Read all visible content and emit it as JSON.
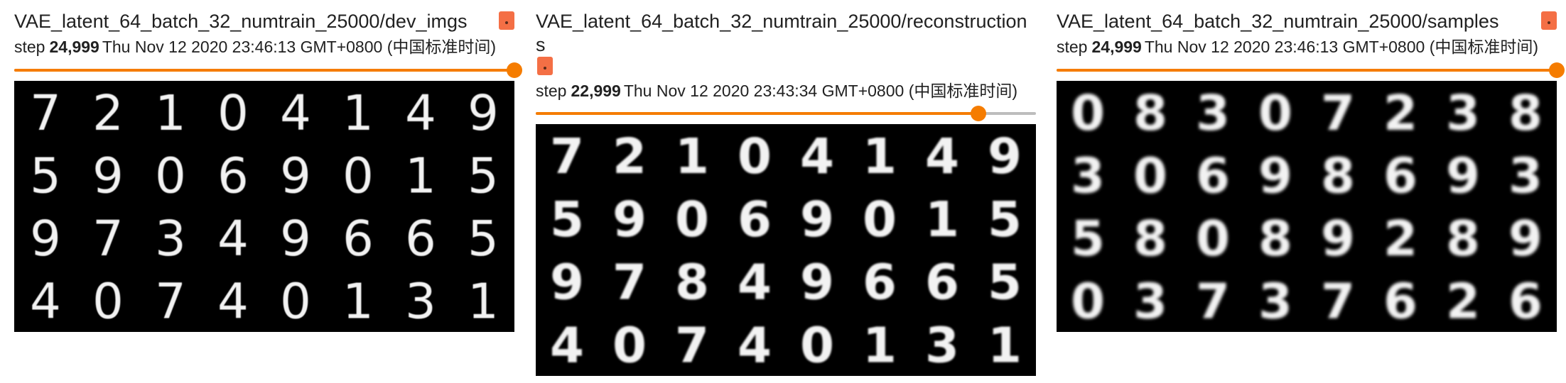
{
  "colors": {
    "accent": "#f57c00",
    "pin": "#f46f45",
    "image_bg": "#000000"
  },
  "cards": [
    {
      "title": "VAE_latent_64_batch_32_numtrain_25000/dev_imgs",
      "step_label": "step",
      "step_value": "24,999",
      "timestamp": "Thu Nov 12 2020 23:46:13 GMT+0800 (中国标准时间)",
      "slider_fraction": 1.0,
      "pin_icon": "pin-icon",
      "digits": [
        "7",
        "2",
        "1",
        "0",
        "4",
        "1",
        "4",
        "9",
        "5",
        "9",
        "0",
        "6",
        "9",
        "0",
        "1",
        "5",
        "9",
        "7",
        "3",
        "4",
        "9",
        "6",
        "6",
        "5",
        "4",
        "0",
        "7",
        "4",
        "0",
        "1",
        "3",
        "1"
      ]
    },
    {
      "title": "VAE_latent_64_batch_32_numtrain_25000/reconstructions",
      "step_label": "step",
      "step_value": "22,999",
      "timestamp": "Thu Nov 12 2020 23:43:34 GMT+0800 (中国标准时间)",
      "slider_fraction": 0.885,
      "pin_icon": "pin-icon",
      "digits": [
        "7",
        "2",
        "1",
        "0",
        "4",
        "1",
        "4",
        "9",
        "5",
        "9",
        "0",
        "6",
        "9",
        "0",
        "1",
        "5",
        "9",
        "7",
        "8",
        "4",
        "9",
        "6",
        "6",
        "5",
        "4",
        "0",
        "7",
        "4",
        "0",
        "1",
        "3",
        "1"
      ]
    },
    {
      "title": "VAE_latent_64_batch_32_numtrain_25000/samples",
      "step_label": "step",
      "step_value": "24,999",
      "timestamp": "Thu Nov 12 2020 23:46:13 GMT+0800 (中国标准时间)",
      "slider_fraction": 1.0,
      "pin_icon": "pin-icon",
      "digits": [
        "0",
        "8",
        "3",
        "0",
        "7",
        "2",
        "3",
        "8",
        "3",
        "0",
        "6",
        "9",
        "8",
        "6",
        "9",
        "3",
        "5",
        "8",
        "0",
        "8",
        "9",
        "2",
        "8",
        "9",
        "0",
        "3",
        "7",
        "3",
        "7",
        "6",
        "2",
        "6"
      ]
    }
  ]
}
